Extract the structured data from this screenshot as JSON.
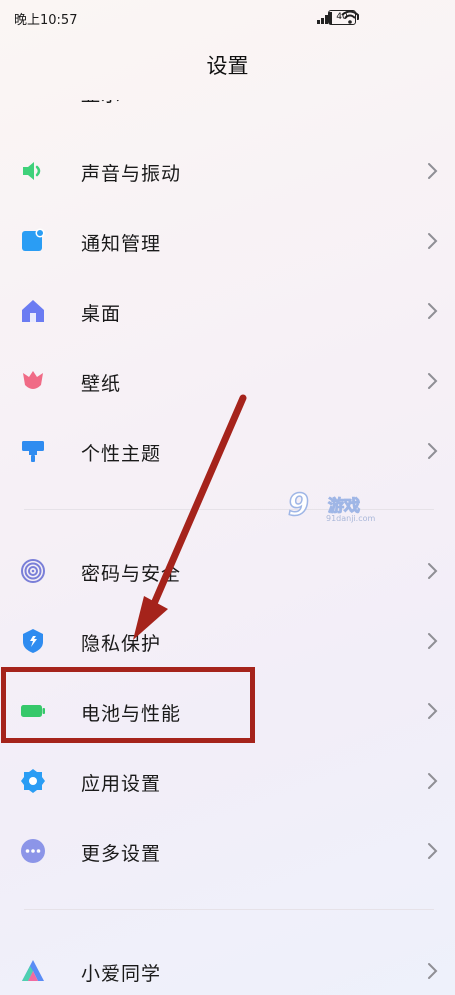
{
  "status_bar": {
    "time": "晚上10:57",
    "battery": "40"
  },
  "header": {
    "title": "设置"
  },
  "settings": {
    "items": [
      {
        "label": "显示",
        "icon": "display-icon"
      },
      {
        "label": "声音与振动",
        "icon": "speaker-icon"
      },
      {
        "label": "通知管理",
        "icon": "notification-icon"
      },
      {
        "label": "桌面",
        "icon": "home-icon"
      },
      {
        "label": "壁纸",
        "icon": "tulip-icon"
      },
      {
        "label": "个性主题",
        "icon": "brush-icon"
      },
      {
        "label": "密码与安全",
        "icon": "fingerprint-icon"
      },
      {
        "label": "隐私保护",
        "icon": "privacy-icon"
      },
      {
        "label": "电池与性能",
        "icon": "battery-icon"
      },
      {
        "label": "应用设置",
        "icon": "gear-icon"
      },
      {
        "label": "更多设置",
        "icon": "more-icon"
      },
      {
        "label": "小爱同学",
        "icon": "xiaoai-icon"
      }
    ]
  },
  "watermark": {
    "brand": "9",
    "text": "游戏",
    "url": "91danji.com"
  },
  "colors": {
    "speaker": "#3fd17a",
    "notification": "#2a9df4",
    "home": "#6b7cf2",
    "tulip": "#f06b86",
    "brush": "#2f8cf0",
    "fingerprint": "#7a7fd8",
    "privacy": "#2f8cf0",
    "battery": "#36c86a",
    "gear": "#2a9df4",
    "more": "#8c95e8",
    "annotation": "#a5231b"
  }
}
